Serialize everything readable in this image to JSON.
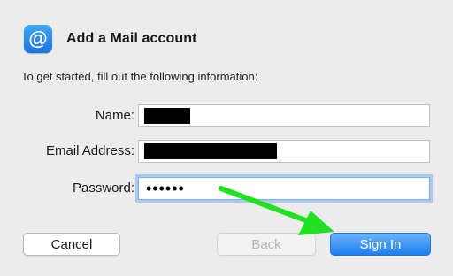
{
  "header": {
    "icon_glyph": "@",
    "title": "Add a Mail account"
  },
  "instructions": "To get started, fill out the following information:",
  "form": {
    "name_label": "Name:",
    "email_label": "Email Address:",
    "password_label": "Password:",
    "password_value": "••••••"
  },
  "buttons": {
    "cancel": "Cancel",
    "back": "Back",
    "sign_in": "Sign In"
  },
  "colors": {
    "accent": "#1c7ef0",
    "arrow": "#22e022"
  },
  "icons": {
    "app": "mail-at-icon",
    "annotation": "green-arrow-annotation"
  }
}
